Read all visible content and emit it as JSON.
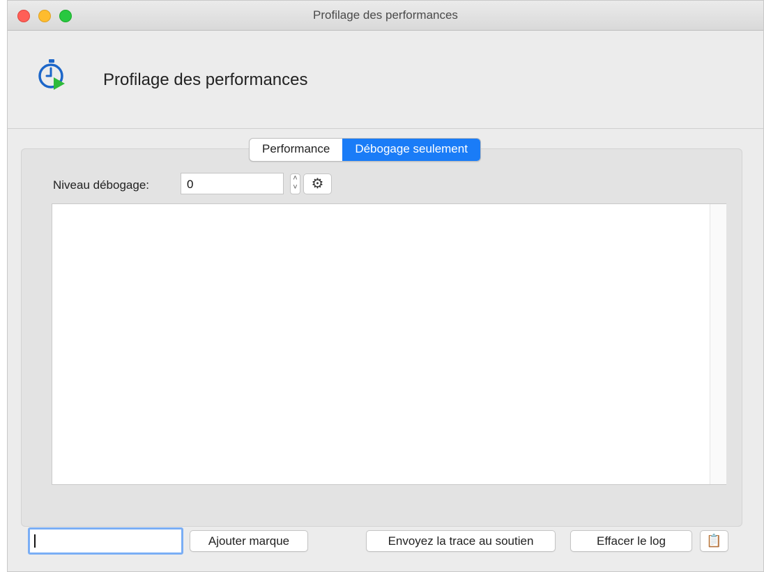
{
  "window": {
    "title": "Profilage des performances"
  },
  "header": {
    "title": "Profilage des performances",
    "icon": "stopwatch-play-icon"
  },
  "tabs": [
    {
      "label": "Performance",
      "active": false
    },
    {
      "label": "Débogage seulement",
      "active": true
    }
  ],
  "debug": {
    "level_label": "Niveau débogage:",
    "level_value": "0",
    "settings_icon": "gear-icon"
  },
  "log": {
    "content": ""
  },
  "bottom": {
    "mark_input_value": "",
    "add_mark_label": "Ajouter marque",
    "send_trace_label": "Envoyez la trace au soutien",
    "clear_log_label": "Effacer le log",
    "copy_icon": "clipboard-icon"
  },
  "colors": {
    "accent": "#1a7cf7",
    "close": "#ff5f57",
    "minimize": "#febc2e",
    "maximize": "#28c840"
  }
}
